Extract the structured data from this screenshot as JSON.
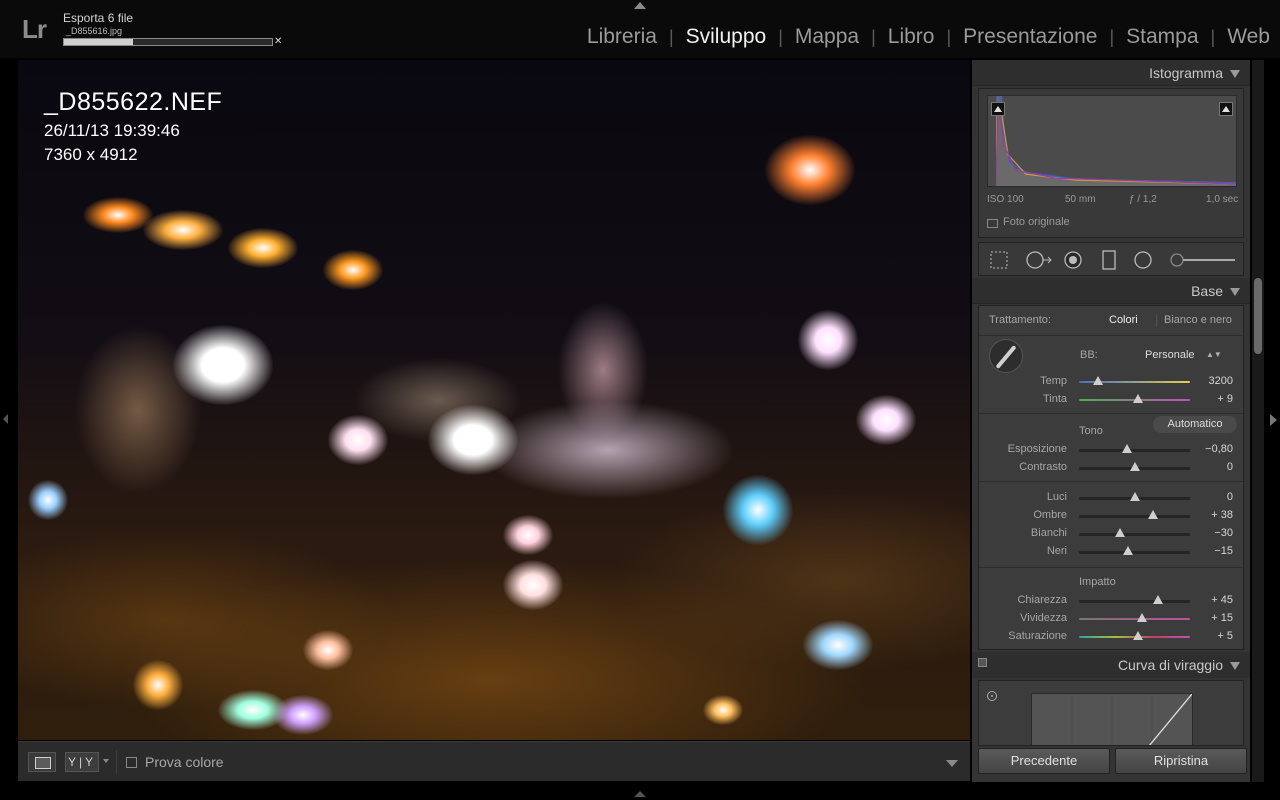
{
  "app": {
    "logo_text": "Lr",
    "export_title": "Esporta 6 file",
    "export_file": "_D855616.jpg",
    "export_progress": 0.33,
    "close_glyph": "✕"
  },
  "modules": [
    {
      "label": "Libreria",
      "active": false
    },
    {
      "label": "Sviluppo",
      "active": true
    },
    {
      "label": "Mappa",
      "active": false
    },
    {
      "label": "Libro",
      "active": false
    },
    {
      "label": "Presentazione",
      "active": false
    },
    {
      "label": "Stampa",
      "active": false
    },
    {
      "label": "Web",
      "active": false
    }
  ],
  "module_separator": "|",
  "photo": {
    "filename": "_D855622.NEF",
    "datetime": "26/11/13 19:39:46",
    "dimensions": "7360 x 4912"
  },
  "toolbar": {
    "view_icon": "loupe-view-icon",
    "before_after_label": "Y|Y",
    "soft_proof_label": "Prova colore",
    "soft_proof_checked": false
  },
  "histogram": {
    "title": "Istogramma",
    "iso": "ISO 100",
    "focal": "50 mm",
    "aperture": "ƒ / 1,2",
    "shutter": "1,0 sec",
    "original_label": "Foto originale"
  },
  "tools": [
    "crop-icon",
    "spot-removal-icon",
    "red-eye-icon",
    "graduated-filter-icon",
    "radial-filter-icon",
    "adjustment-brush-icon"
  ],
  "basic": {
    "title": "Base",
    "treatment_label": "Trattamento:",
    "treatment_color": "Colori",
    "treatment_bw": "Bianco e nero",
    "wb_label": "BB:",
    "wb_value": "Personale",
    "wb_updown": "▲▼",
    "tone_label": "Tono",
    "auto_label": "Automatico",
    "presence_label": "Impatto",
    "sliders": {
      "temp": {
        "label": "Temp",
        "value": "3200",
        "pos": 0.17
      },
      "tint": {
        "label": "Tinta",
        "value": "+ 9",
        "pos": 0.53
      },
      "exposure": {
        "label": "Esposizione",
        "value": "−0,80",
        "pos": 0.43
      },
      "contrast": {
        "label": "Contrasto",
        "value": "0",
        "pos": 0.5
      },
      "highlights": {
        "label": "Luci",
        "value": "0",
        "pos": 0.5
      },
      "shadows": {
        "label": "Ombre",
        "value": "+ 38",
        "pos": 0.67
      },
      "whites": {
        "label": "Bianchi",
        "value": "−30",
        "pos": 0.37
      },
      "blacks": {
        "label": "Neri",
        "value": "−15",
        "pos": 0.44
      },
      "clarity": {
        "label": "Chiarezza",
        "value": "+ 45",
        "pos": 0.71
      },
      "vibrance": {
        "label": "Vividezza",
        "value": "+ 15",
        "pos": 0.57
      },
      "saturation": {
        "label": "Saturazione",
        "value": "+ 5",
        "pos": 0.53
      }
    }
  },
  "tone_curve": {
    "title": "Curva di viraggio"
  },
  "buttons": {
    "previous": "Precedente",
    "reset": "Ripristina"
  },
  "colors": {
    "panel_bg": "#343434",
    "active_module": "#f2f2f2",
    "inactive_module": "#9a9a9a"
  }
}
